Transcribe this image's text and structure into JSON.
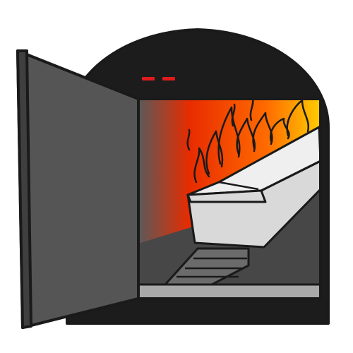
{
  "illustration": {
    "subject": "cremation-oven",
    "background_color": "#ffffff",
    "outline_color": "#1a1a1a",
    "colors": {
      "oven_body": "#1c1c1c",
      "door": "#555555",
      "door_edge": "#3f3f3f",
      "chamber_floor": "#474747",
      "rail_track": "#6b6b6b",
      "threshold": "#a9a9a9",
      "coffin": "#d9d9d9",
      "coffin_lid": "#efefef",
      "indicator_lights": "#e01b1b",
      "fire_hot": "#ffcc00",
      "fire_mid": "#ff6a00",
      "fire_deep": "#e82b00",
      "chamber_shadow": "#5a5a5a"
    },
    "indicator_light_count": 2
  }
}
